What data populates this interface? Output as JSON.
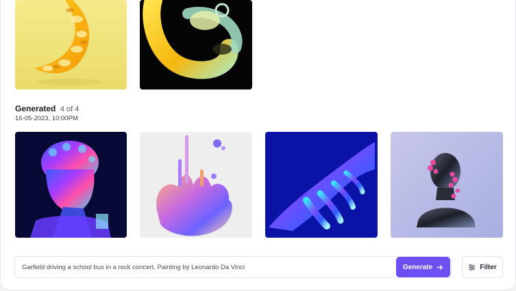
{
  "previous_group": {
    "images": [
      {
        "subject": "yellow twisted chain sculpture on pale yellow background"
      },
      {
        "subject": "yellow translucent loop sculpture on black background"
      }
    ]
  },
  "generated_group": {
    "title": "Generated",
    "count": "4 of 4",
    "date": "16-05-2023,  10:00PM",
    "images": [
      {
        "subject": "holographic chrome bust on dark navy background"
      },
      {
        "subject": "iridescent liquid metal splash on light grey background"
      },
      {
        "subject": "holographic chrome hand on deep blue background"
      },
      {
        "subject": "dark chrome bust with pink flowers on lavender background"
      }
    ]
  },
  "prompt": {
    "value": "Garfield driving a school bus in a rock concert, Painting by Leonardo Da Vinci"
  },
  "generate_button": {
    "label": "Generate",
    "icon": "arrow-right-icon"
  },
  "filter_button": {
    "label": "Filter",
    "icon": "sliders-icon"
  },
  "colors": {
    "accent": "#6e4ff3"
  }
}
